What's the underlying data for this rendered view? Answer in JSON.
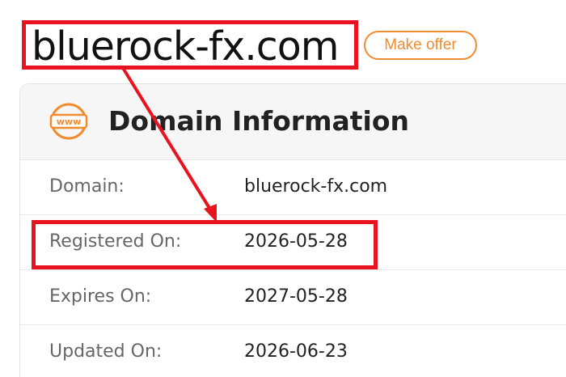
{
  "domain": {
    "name": "bluerock-fx.com",
    "make_offer_label": "Make offer"
  },
  "card": {
    "icon": "www-icon",
    "title": "Domain Information",
    "rows": [
      {
        "label": "Domain:",
        "value": "bluerock-fx.com"
      },
      {
        "label": "Registered On:",
        "value": "2026-05-28"
      },
      {
        "label": "Expires On:",
        "value": "2027-05-28"
      },
      {
        "label": "Updated On:",
        "value": "2026-06-23"
      }
    ]
  },
  "colors": {
    "accent": "#f08b2e",
    "annotation_red": "#e8131f",
    "header_bg": "#f6f6f6",
    "label_text": "#666666",
    "value_text": "#222222"
  }
}
